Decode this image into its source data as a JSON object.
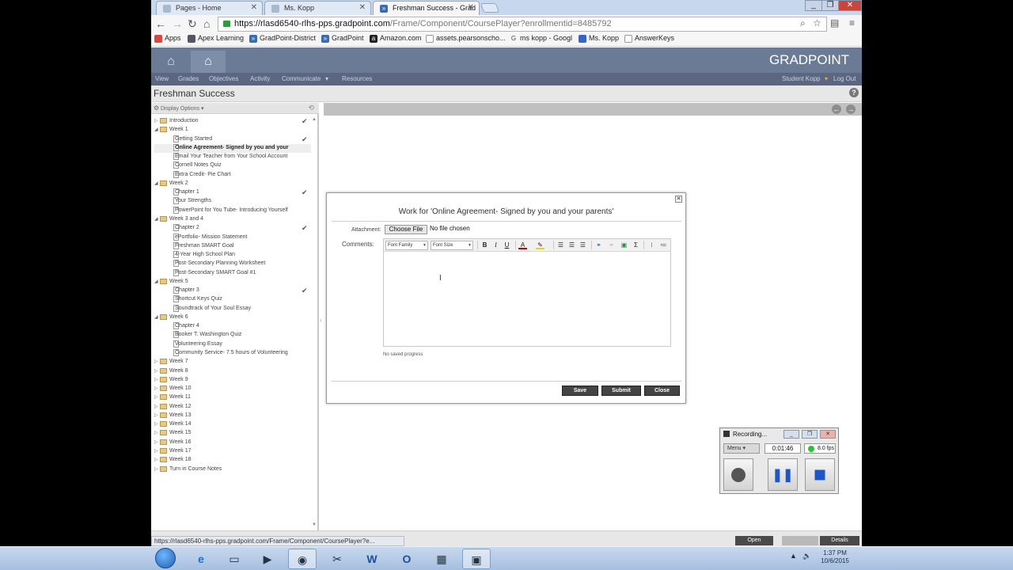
{
  "browser": {
    "tabs": [
      {
        "title": "Pages - Home"
      },
      {
        "title": "Ms. Kopp"
      },
      {
        "title": "Freshman Success - Grad"
      }
    ],
    "url_host": "https://rlasd6540-rlhs-pps.gradpoint.com",
    "url_path": "/Frame/Component/CoursePlayer?enrollmentid=8485792",
    "bookmarks": [
      {
        "label": "Apps"
      },
      {
        "label": "Apex Learning"
      },
      {
        "label": "GradPoint-District"
      },
      {
        "label": "GradPoint"
      },
      {
        "label": "Amazon.com"
      },
      {
        "label": "assets.pearsonscho..."
      },
      {
        "label": "ms kopp - Googl"
      },
      {
        "label": "Ms. Kopp"
      },
      {
        "label": "AnswerKeys"
      }
    ],
    "status_url": "https://rlasd6540-rlhs-pps.gradpoint.com/Frame/Component/CoursePlayer?e..."
  },
  "header": {
    "logo": "GRADPOINT",
    "nav": [
      "View",
      "Grades",
      "Objectives",
      "Activity",
      "Communicate",
      "Resources"
    ],
    "user": "Student Kopp",
    "logout": "Log Out"
  },
  "course_title": "Freshman Success",
  "display_options": "Display Options",
  "tree": [
    {
      "label": "Introduction",
      "type": "folder",
      "level": 0,
      "check": true
    },
    {
      "label": "Week 1",
      "type": "folder",
      "level": 0,
      "open": true
    },
    {
      "label": "Getting Started",
      "type": "page",
      "level": 1,
      "check": true
    },
    {
      "label": "Online Agreement- Signed by you and your",
      "type": "page",
      "level": 1,
      "selected": true
    },
    {
      "label": "Email Your Teacher from Your School Account",
      "type": "page",
      "level": 1
    },
    {
      "label": "Cornell Notes Quiz",
      "type": "page",
      "level": 1
    },
    {
      "label": "Extra Credit- Pie Chart",
      "type": "page",
      "level": 1
    },
    {
      "label": "Week 2",
      "type": "folder",
      "level": 0,
      "open": true
    },
    {
      "label": "Chapter 1",
      "type": "page",
      "level": 1,
      "check": true
    },
    {
      "label": "Your Strengths",
      "type": "page",
      "level": 1
    },
    {
      "label": "PowerPoint for You Tube- Introducing Yourself",
      "type": "page",
      "level": 1
    },
    {
      "label": "Week 3 and 4",
      "type": "folder",
      "level": 0,
      "open": true
    },
    {
      "label": "Chapter 2",
      "type": "page",
      "level": 1,
      "check": true
    },
    {
      "label": "ePortfolio- Mission Statement",
      "type": "page",
      "level": 1
    },
    {
      "label": "Freshman SMART Goal",
      "type": "page",
      "level": 1
    },
    {
      "label": "4-Year High School Plan",
      "type": "page",
      "level": 1
    },
    {
      "label": "Post-Secondary Planning Worksheet",
      "type": "page",
      "level": 1
    },
    {
      "label": "Post-Secondary SMART Goal #1",
      "type": "page",
      "level": 1
    },
    {
      "label": "Week 5",
      "type": "folder",
      "level": 0,
      "open": true
    },
    {
      "label": "Chapter 3",
      "type": "page",
      "level": 1,
      "check": true
    },
    {
      "label": "Shortcut Keys Quiz",
      "type": "page",
      "level": 1
    },
    {
      "label": "Soundtrack of Your Soul Essay",
      "type": "page",
      "level": 1
    },
    {
      "label": "Week 6",
      "type": "folder",
      "level": 0,
      "open": true
    },
    {
      "label": "Chapter 4",
      "type": "page",
      "level": 1
    },
    {
      "label": "Booker T. Washington Quiz",
      "type": "page",
      "level": 1
    },
    {
      "label": "Volunteering Essay",
      "type": "page",
      "level": 1
    },
    {
      "label": "Community Service- 7.5 hours of Volunteering",
      "type": "page",
      "level": 1
    },
    {
      "label": "Week 7",
      "type": "folder",
      "level": 0
    },
    {
      "label": "Week 8",
      "type": "folder",
      "level": 0
    },
    {
      "label": "Week 9",
      "type": "folder",
      "level": 0
    },
    {
      "label": "Week 10",
      "type": "folder",
      "level": 0
    },
    {
      "label": "Week 11",
      "type": "folder",
      "level": 0
    },
    {
      "label": "Week 12",
      "type": "folder",
      "level": 0
    },
    {
      "label": "Week 13",
      "type": "folder",
      "level": 0
    },
    {
      "label": "Week 14",
      "type": "folder",
      "level": 0
    },
    {
      "label": "Week 15",
      "type": "folder",
      "level": 0
    },
    {
      "label": "Week 16",
      "type": "folder",
      "level": 0
    },
    {
      "label": "Week 17",
      "type": "folder",
      "level": 0
    },
    {
      "label": "Week 18",
      "type": "folder",
      "level": 0
    },
    {
      "label": "Turn in Course Notes",
      "type": "folder",
      "level": 0
    }
  ],
  "dialog": {
    "title": "Work for 'Online Agreement- Signed by you and your parents'",
    "attachment_label": "Attachment:",
    "choose_file": "Choose File",
    "no_file": "No file chosen",
    "comments_label": "Comments:",
    "font_family": "Font Family",
    "font_size": "Font Size",
    "no_saved": "No saved progress",
    "save": "Save",
    "submit": "Submit",
    "close": "Close"
  },
  "recorder": {
    "title": "Recording...",
    "menu": "Menu",
    "time": "0:01:46",
    "fps": "8.0 fps"
  },
  "footer": {
    "open": "Open",
    "details": "Details"
  },
  "taskbar": {
    "time": "1:37 PM",
    "date": "10/6/2015"
  }
}
